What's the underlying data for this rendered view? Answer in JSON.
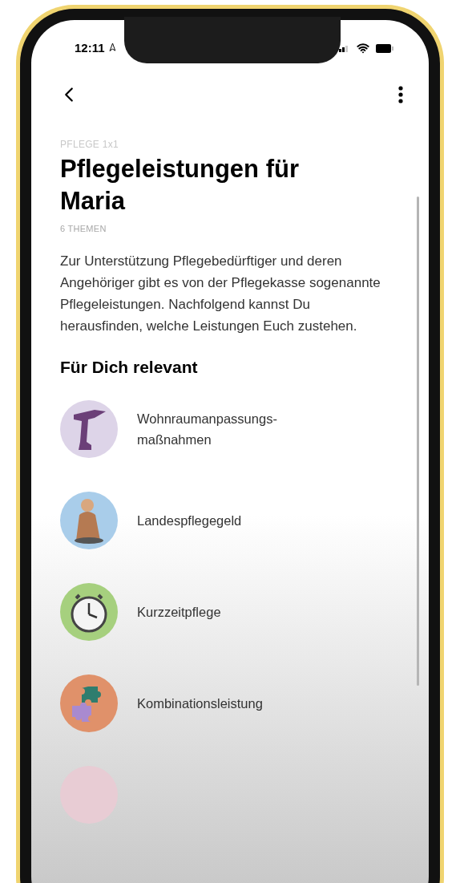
{
  "status_bar": {
    "time": "12:11"
  },
  "header": {
    "eyebrow": "PFLEGE 1x1",
    "title": "Pflegeleistungen für Maria",
    "subtitle": "6 THEMEN"
  },
  "intro": "Zur Unterstützung Pflegebedürftiger und deren Angehöriger gibt es von der Pflegekasse sogenannte Pflegeleistungen. Nachfolgend kannst Du herausfinden, welche Leistungen Euch zustehen.",
  "section": {
    "title": "Für Dich relevant",
    "items": [
      {
        "kind": "drill",
        "label": "Wohnraumanpassungs-\nmaßnahmen",
        "color": "#ddd4e8"
      },
      {
        "kind": "person",
        "label": "Landespflegegeld",
        "color": "#a9cdea"
      },
      {
        "kind": "clock",
        "label": "Kurzzeitpflege",
        "color": "#a6d07e"
      },
      {
        "kind": "puzzle",
        "label": "Kombinationsleistung",
        "color": "#e0916a"
      },
      {
        "kind": "faded",
        "color": "#e8ccd4"
      }
    ]
  }
}
